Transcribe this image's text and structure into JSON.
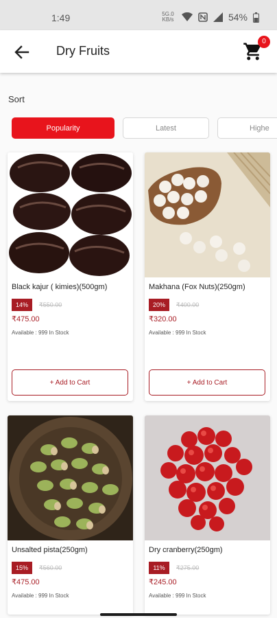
{
  "status_bar": {
    "time": "1:49",
    "network": "5G.0 KB/s",
    "battery_pct": "54%"
  },
  "header": {
    "title": "Dry Fruits",
    "cart_count": "0"
  },
  "sort": {
    "label": "Sort",
    "options": [
      "Popularity",
      "Latest",
      "Highe"
    ],
    "selected": "Popularity"
  },
  "products": [
    {
      "name": "Black kajur ( kimies)(500gm)",
      "discount": "14%",
      "mrp": "₹550.00",
      "price": "₹475.00",
      "availability": "Available : 999 In Stock",
      "button": "+ Add to Cart"
    },
    {
      "name": "Makhana (Fox Nuts)(250gm)",
      "discount": "20%",
      "mrp": "₹400.00",
      "price": "₹320.00",
      "availability": "Available : 999 In Stock",
      "button": "+ Add to Cart"
    },
    {
      "name": "Unsalted pista(250gm)",
      "discount": "15%",
      "mrp": "₹560.00",
      "price": "₹475.00",
      "availability": "Available : 999 In Stock"
    },
    {
      "name": "Dry cranberry(250gm)",
      "discount": "11%",
      "mrp": "₹275.00",
      "price": "₹245.00",
      "availability": "Available : 999 In Stock"
    }
  ],
  "colors": {
    "accent": "#e8141c",
    "price": "#a81c24"
  }
}
